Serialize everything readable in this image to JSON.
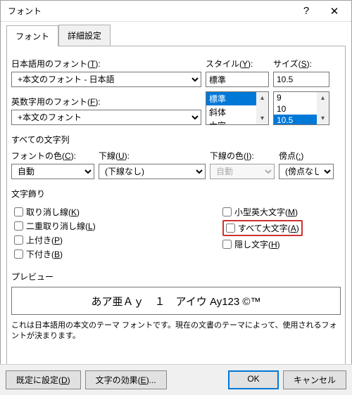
{
  "titlebar": {
    "title": "フォント",
    "help": "?",
    "close": "✕"
  },
  "tabs": {
    "font": "フォント",
    "advanced": "詳細設定"
  },
  "labels": {
    "jpFont": "日本語用のフォント(<span class='u'>T</span>):",
    "jpFontValue": "+本文のフォント - 日本語",
    "latinFont": "英数字用のフォント(<span class='u'>F</span>):",
    "latinFontValue": "+本文のフォント",
    "style": "スタイル(<span class='u'>Y</span>):",
    "styleValue": "標準",
    "size": "サイズ(<span class='u'>S</span>):",
    "sizeValue": "10.5",
    "allChars": "すべての文字列",
    "fontColor": "フォントの色(<span class='u'>C</span>):",
    "fontColorValue": "自動",
    "underline": "下線(<span class='u'>U</span>):",
    "underlineValue": "(下線なし)",
    "underlineColor": "下線の色(<span class='u'>I</span>):",
    "underlineColorValue": "自動",
    "emphasis": "傍点(<span class='u'>:</span>)",
    "emphasisValue": "(傍点なし)",
    "decoration": "文字飾り",
    "strikethrough": "取り消し線(<span class='u'>K</span>)",
    "dblStrikethrough": "二重取り消し線(<span class='u'>L</span>)",
    "superscript": "上付き(<span class='u'>P</span>)",
    "subscript": "下付き(<span class='u'>B</span>)",
    "smallCaps": "小型英大文字(<span class='u'>M</span>)",
    "allCaps": "すべて大文字(<span class='u'>A</span>)",
    "hidden": "隠し文字(<span class='u'>H</span>)",
    "preview": "プレビュー",
    "previewText": "あア亜Ａｙ　１　アイウ Ay123 ©™",
    "note": "これは日本語用の本文のテーマ フォントです。現在の文書のテーマによって、使用されるフォントが決まります。"
  },
  "styleList": [
    "標準",
    "斜体",
    "太字"
  ],
  "sizeList": [
    "9",
    "10",
    "10.5"
  ],
  "footer": {
    "setDefault": "既定に設定(<span class='u'>D</span>)",
    "textEffects": "文字の効果(<span class='u'>E</span>)...",
    "ok": "OK",
    "cancel": "キャンセル"
  }
}
